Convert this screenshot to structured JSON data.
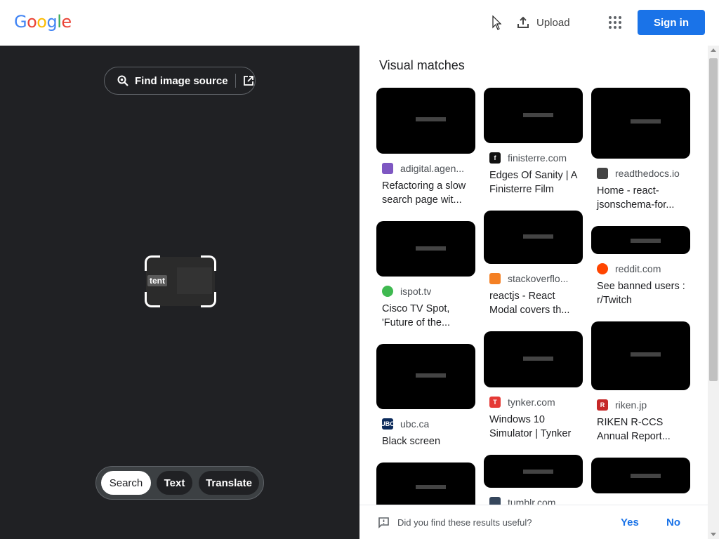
{
  "header": {
    "logo_letters": [
      {
        "ch": "G",
        "color": "#4285f4"
      },
      {
        "ch": "o",
        "color": "#ea4335"
      },
      {
        "ch": "o",
        "color": "#fbbc05"
      },
      {
        "ch": "g",
        "color": "#4285f4"
      },
      {
        "ch": "l",
        "color": "#34a853"
      },
      {
        "ch": "e",
        "color": "#ea4335"
      }
    ],
    "upload_label": "Upload",
    "signin_label": "Sign in"
  },
  "left": {
    "find_source_label": "Find image source",
    "crop_word": "tent",
    "modes": [
      "Search",
      "Text",
      "Translate"
    ],
    "selected_mode": "Search"
  },
  "results": {
    "title": "Visual matches",
    "columns": [
      [
        {
          "source": "adigital.agen...",
          "favicon": "adigital-icon",
          "fav_color": "#7e57c2",
          "title": "Refactoring a slow search page wit...",
          "thumb_h": 94
        },
        {
          "source": "ispot.tv",
          "favicon": "ispot-icon",
          "fav_color": "#3fb950",
          "title": "Cisco TV Spot, 'Future of the...",
          "thumb_h": 79
        },
        {
          "source": "ubc.ca",
          "favicon": "ubc-icon",
          "fav_color": "#0b2a5b",
          "fav_text": "UBC",
          "title": "Black screen",
          "thumb_h": 93
        },
        {
          "source": "",
          "favicon": "",
          "fav_color": "#ffffff",
          "title": "",
          "thumb_h": 70
        }
      ],
      [
        {
          "source": "finisterre.com",
          "favicon": "finisterre-icon",
          "fav_color": "#111111",
          "fav_text": "f",
          "title": "Edges Of Sanity | A Finisterre Film",
          "thumb_h": 79
        },
        {
          "source": "stackoverflo...",
          "favicon": "stackoverflow-icon",
          "fav_color": "#f48024",
          "title": "reactjs - React Modal covers th...",
          "thumb_h": 76
        },
        {
          "source": "tynker.com",
          "favicon": "tynker-icon",
          "fav_color": "#e53935",
          "fav_text": "T",
          "title": "Windows 10 Simulator | Tynker",
          "thumb_h": 80
        },
        {
          "source": "tumblr.com",
          "favicon": "tumblr-icon",
          "fav_color": "#35465c",
          "title": "",
          "thumb_h": 47
        }
      ],
      [
        {
          "source": "readthedocs.io",
          "favicon": "readthedocs-icon",
          "fav_color": "#444444",
          "title": "Home - react-jsonschema-for...",
          "thumb_h": 101
        },
        {
          "source": "reddit.com",
          "favicon": "reddit-icon",
          "fav_color": "#ff4500",
          "title": "See banned users : r/Twitch",
          "thumb_h": 40
        },
        {
          "source": "riken.jp",
          "favicon": "riken-icon",
          "fav_color": "#c62828",
          "fav_text": "R",
          "title": "RIKEN R-CCS Annual Report...",
          "thumb_h": 98
        },
        {
          "source": "",
          "favicon": "",
          "fav_color": "#4fc3f7",
          "title": "",
          "thumb_h": 51
        }
      ]
    ]
  },
  "feedback": {
    "question": "Did you find these results useful?",
    "yes": "Yes",
    "no": "No"
  }
}
